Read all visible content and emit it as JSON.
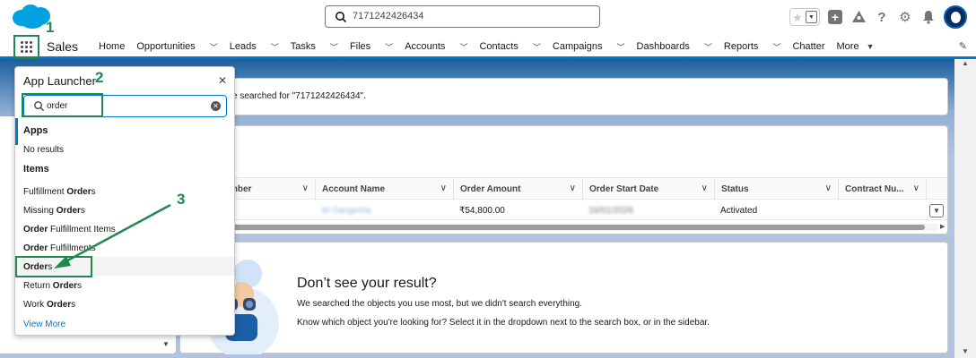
{
  "header": {
    "search_value": "7171242426434",
    "app_name": "Sales"
  },
  "nav": {
    "items": [
      {
        "label": "Home",
        "dropdown": false
      },
      {
        "label": "Opportunities",
        "dropdown": true
      },
      {
        "label": "Leads",
        "dropdown": true
      },
      {
        "label": "Tasks",
        "dropdown": true
      },
      {
        "label": "Files",
        "dropdown": true
      },
      {
        "label": "Accounts",
        "dropdown": true
      },
      {
        "label": "Contacts",
        "dropdown": true
      },
      {
        "label": "Campaigns",
        "dropdown": true
      },
      {
        "label": "Dashboards",
        "dropdown": true
      },
      {
        "label": "Reports",
        "dropdown": true
      },
      {
        "label": "Chatter",
        "dropdown": false
      },
      {
        "label": "More",
        "dropdown": "caret"
      }
    ]
  },
  "background": {
    "search_message": "e searched for \"7171242426434\".",
    "table": {
      "columns": [
        "mber",
        "Account Name",
        "Order Amount",
        "Order Start Date",
        "Status",
        "Contract Nu..."
      ],
      "row": {
        "account_name": "W-Sangeeta",
        "amount": "₹54,800.00",
        "start_date": "16/01/2026",
        "status": "Activated"
      }
    },
    "no_result": {
      "title": "Don’t see your result?",
      "line1": "We searched the objects you use most, but we didn't search everything.",
      "line2": "Know which object you're looking for? Select it in the dropdown next to the search box, or in the sidebar."
    }
  },
  "launcher": {
    "title": "App Launcher",
    "search_value": "order",
    "apps_heading": "Apps",
    "apps_empty": "No results",
    "items_heading": "Items",
    "items": [
      {
        "prefix": "Fulfillment ",
        "bold": "Order",
        "suffix": "s"
      },
      {
        "prefix": "Missing ",
        "bold": "Order",
        "suffix": "s"
      },
      {
        "prefix": "",
        "bold": "Order",
        "suffix": " Fulfillment Items"
      },
      {
        "prefix": "",
        "bold": "Order",
        "suffix": " Fulfillments"
      },
      {
        "prefix": "",
        "bold": "Order",
        "suffix": "s"
      },
      {
        "prefix": "Return ",
        "bold": "Order",
        "suffix": "s"
      },
      {
        "prefix": "Work ",
        "bold": "Order",
        "suffix": "s"
      }
    ],
    "view_more": "View More"
  },
  "annotations": {
    "step1": "1",
    "step2": "2",
    "step3": "3",
    "color": "#1e8a4f"
  },
  "colors": {
    "brand": "#0176d3",
    "annotation": "#1e8a4f"
  }
}
